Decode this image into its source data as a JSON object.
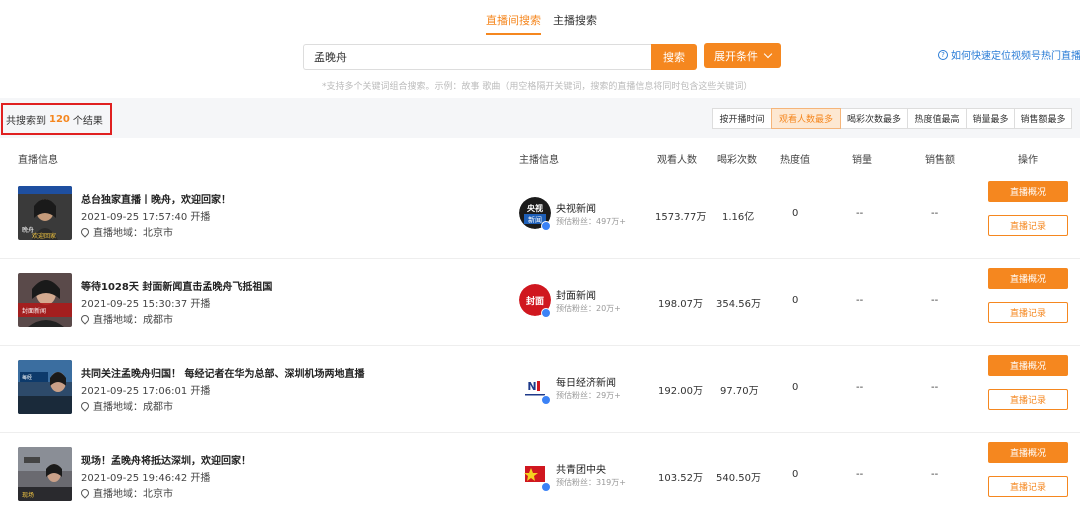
{
  "tabs": [
    {
      "label": "直播间搜索",
      "active": true
    },
    {
      "label": "主播搜索",
      "active": false
    }
  ],
  "search": {
    "value": "孟晚舟",
    "button": "搜索",
    "expand": "展开条件",
    "help": "如何快速定位视频号热门直播间",
    "hint": "*支持多个关键词组合搜索。示例：故事 歌曲（用空格隔开关键词，搜索的直播信息将同时包含这些关键词）"
  },
  "result": {
    "prefix": "共搜索到",
    "count": "120",
    "suffix": "个结果"
  },
  "sort": [
    {
      "label": "按开播时间",
      "active": false
    },
    {
      "label": "观看人数最多",
      "active": true
    },
    {
      "label": "喝彩次数最多",
      "active": false
    },
    {
      "label": "热度值最高",
      "active": false
    },
    {
      "label": "销量最多",
      "active": false
    },
    {
      "label": "销售额最多",
      "active": false
    }
  ],
  "columns": {
    "live": "直播信息",
    "host": "主播信息",
    "viewers": "观看人数",
    "cheers": "喝彩次数",
    "heat": "热度值",
    "sales": "销量",
    "revenue": "销售额",
    "ops": "操作"
  },
  "actions": {
    "overview": "直播概况",
    "record": "直播记录"
  },
  "rows": [
    {
      "title": "总台独家直播丨晚舟，欢迎回家！",
      "time": "2021-09-25 17:57:40 开播",
      "location": "直播地域：北京市",
      "host": "央视新闻",
      "fans": "预估粉丝：497万+",
      "viewers": "1573.77万",
      "cheers": "1.16亿",
      "heat": "0",
      "sales": "--",
      "revenue": "--"
    },
    {
      "title": "等待1028天 封面新闻直击孟晚舟飞抵祖国",
      "time": "2021-09-25 15:30:37 开播",
      "location": "直播地域：成都市",
      "host": "封面新闻",
      "fans": "预估粉丝：20万+",
      "viewers": "198.07万",
      "cheers": "354.56万",
      "heat": "0",
      "sales": "--",
      "revenue": "--"
    },
    {
      "title": "共同关注孟晚舟归国！ 每经记者在华为总部、深圳机场两地直播",
      "time": "2021-09-25 17:06:01 开播",
      "location": "直播地域：成都市",
      "host": "每日经济新闻",
      "fans": "预估粉丝：29万+",
      "viewers": "192.00万",
      "cheers": "97.70万",
      "heat": "0",
      "sales": "--",
      "revenue": "--"
    },
    {
      "title": "现场！孟晚舟将抵达深圳，欢迎回家！",
      "time": "2021-09-25 19:46:42 开播",
      "location": "直播地域：北京市",
      "host": "共青团中央",
      "fans": "预估粉丝：319万+",
      "viewers": "103.52万",
      "cheers": "540.50万",
      "heat": "0",
      "sales": "--",
      "revenue": "--"
    }
  ],
  "thumb_text": [
    "晚舟",
    "欢迎回家",
    "封面新闻",
    "每经",
    "现场"
  ],
  "avatar_text": {
    "cctv": "央视",
    "cctv2": "新闻",
    "cover": "封面",
    "nbd": "N"
  },
  "colors": {
    "accent": "#f5871f",
    "link": "#2a7cd6",
    "highlight": "#e02020"
  }
}
